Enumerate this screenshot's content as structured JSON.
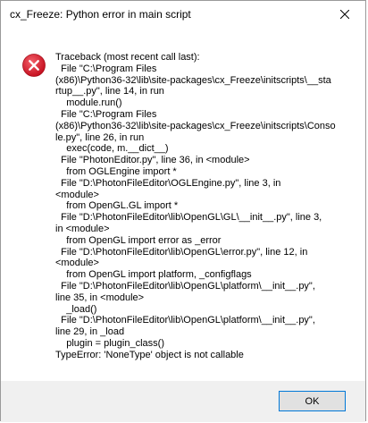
{
  "window": {
    "title": "cx_Freeze: Python error in main script"
  },
  "message": {
    "lines": [
      "Traceback (most recent call last):",
      "  File \"C:\\Program Files",
      "(x86)\\Python36-32\\lib\\site-packages\\cx_Freeze\\initscripts\\__sta",
      "rtup__.py\", line 14, in run",
      "    module.run()",
      "  File \"C:\\Program Files",
      "(x86)\\Python36-32\\lib\\site-packages\\cx_Freeze\\initscripts\\Conso",
      "le.py\", line 26, in run",
      "    exec(code, m.__dict__)",
      "  File \"PhotonEditor.py\", line 36, in <module>",
      "    from OGLEngine import *",
      "  File \"D:\\PhotonFileEditor\\OGLEngine.py\", line 3, in",
      "<module>",
      "    from OpenGL.GL import *",
      "  File \"D:\\PhotonFileEditor\\lib\\OpenGL\\GL\\__init__.py\", line 3,",
      "in <module>",
      "    from OpenGL import error as _error",
      "  File \"D:\\PhotonFileEditor\\lib\\OpenGL\\error.py\", line 12, in",
      "<module>",
      "    from OpenGL import platform, _configflags",
      "  File \"D:\\PhotonFileEditor\\lib\\OpenGL\\platform\\__init__.py\",",
      "line 35, in <module>",
      "    _load()",
      "  File \"D:\\PhotonFileEditor\\lib\\OpenGL\\platform\\__init__.py\",",
      "line 29, in _load",
      "    plugin = plugin_class()",
      "TypeError: 'NoneType' object is not callable"
    ]
  },
  "buttons": {
    "ok_label": "OK"
  },
  "icons": {
    "error": "error-icon",
    "close": "close-icon"
  },
  "colors": {
    "error_red": "#e81123",
    "footer_bg": "#f0f0f0",
    "button_border": "#0078d7",
    "button_bg": "#e1e1e1"
  }
}
